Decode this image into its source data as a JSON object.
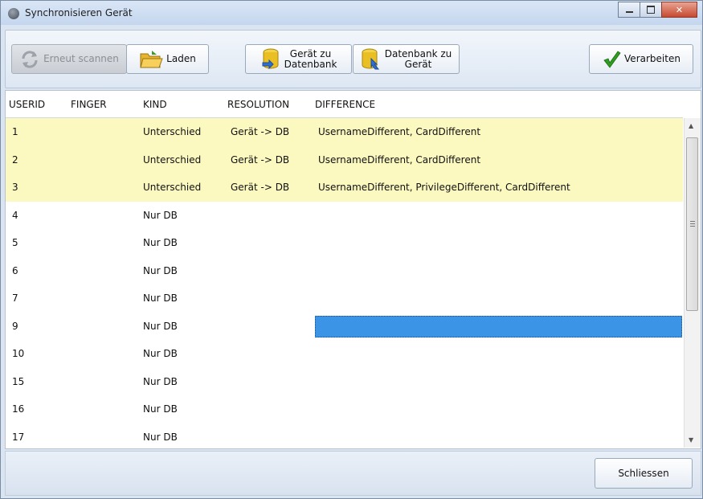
{
  "window": {
    "title": "Synchronisieren Gerät"
  },
  "toolbar": {
    "rescan_label": "Erneut scannen",
    "load_label": "Laden",
    "device_to_db_label": "Gerät zu\nDatenbank",
    "db_to_device_label": "Datenbank zu\nGerät",
    "process_label": "Verarbeiten"
  },
  "grid": {
    "columns": [
      "USERID",
      "FINGER",
      "KIND",
      "RESOLUTION",
      "DIFFERENCE"
    ],
    "rows": [
      {
        "userid": "1",
        "finger": "",
        "kind": "Unterschied",
        "resolution": "Gerät -> DB",
        "difference": "UsernameDifferent, CardDifferent"
      },
      {
        "userid": "2",
        "finger": "",
        "kind": "Unterschied",
        "resolution": "Gerät -> DB",
        "difference": "UsernameDifferent, CardDifferent"
      },
      {
        "userid": "3",
        "finger": "",
        "kind": "Unterschied",
        "resolution": "Gerät -> DB",
        "difference": "UsernameDifferent, PrivilegeDifferent, CardDifferent"
      },
      {
        "userid": "4",
        "finger": "",
        "kind": "Nur DB",
        "resolution": "",
        "difference": ""
      },
      {
        "userid": "5",
        "finger": "",
        "kind": "Nur DB",
        "resolution": "",
        "difference": ""
      },
      {
        "userid": "6",
        "finger": "",
        "kind": "Nur DB",
        "resolution": "",
        "difference": ""
      },
      {
        "userid": "7",
        "finger": "",
        "kind": "Nur DB",
        "resolution": "",
        "difference": ""
      },
      {
        "userid": "9",
        "finger": "",
        "kind": "Nur DB",
        "resolution": "",
        "difference": ""
      },
      {
        "userid": "10",
        "finger": "",
        "kind": "Nur DB",
        "resolution": "",
        "difference": ""
      },
      {
        "userid": "15",
        "finger": "",
        "kind": "Nur DB",
        "resolution": "",
        "difference": ""
      },
      {
        "userid": "16",
        "finger": "",
        "kind": "Nur DB",
        "resolution": "",
        "difference": ""
      },
      {
        "userid": "17",
        "finger": "",
        "kind": "Nur DB",
        "resolution": "",
        "difference": ""
      }
    ],
    "selected_row_userid": "9",
    "difference_highlight_color": "#fcf9c0",
    "selection_color": "#3c94e6"
  },
  "footer": {
    "close_label": "Schliessen"
  }
}
